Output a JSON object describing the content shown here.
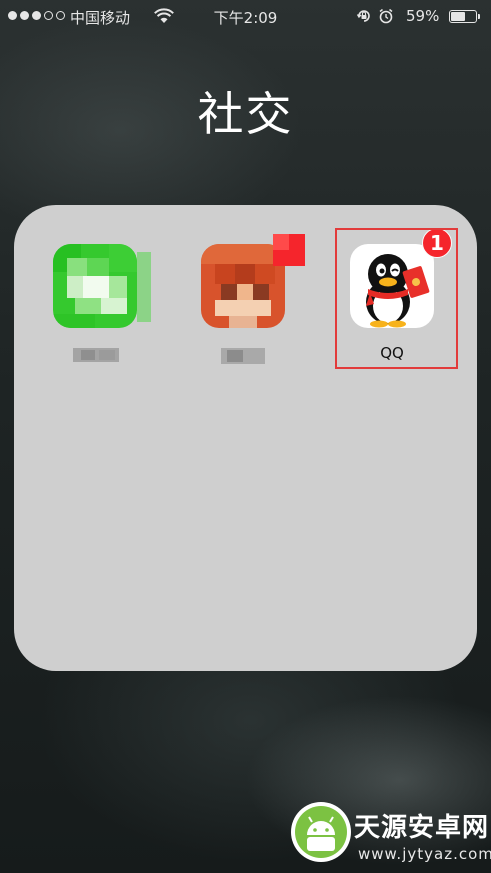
{
  "status_bar": {
    "carrier": "中国移动",
    "time": "下午2:09",
    "battery_percent_text": "59%",
    "battery_level": 0.59,
    "signal_bars_filled": 3,
    "signal_bars_total": 5
  },
  "folder": {
    "title": "社交",
    "apps": [
      {
        "id": "wechat",
        "label": "",
        "badge": "",
        "pixelated": true,
        "icon": "chat-bubble-icon",
        "color": "#2fc82a"
      },
      {
        "id": "second-app",
        "label": "",
        "badge": "",
        "pixelated": true,
        "icon": "fox-icon",
        "color": "#d8532c"
      },
      {
        "id": "qq",
        "label": "QQ",
        "badge": "1",
        "pixelated": false,
        "icon": "qq-penguin-icon",
        "highlighted": true
      }
    ]
  },
  "colors": {
    "badge": "#f5252c",
    "highlight": "#e23b3b",
    "folder_bg": "#cfcfcf"
  },
  "watermark": {
    "title": "天源安卓网",
    "url": "www.jytyaz.com"
  }
}
